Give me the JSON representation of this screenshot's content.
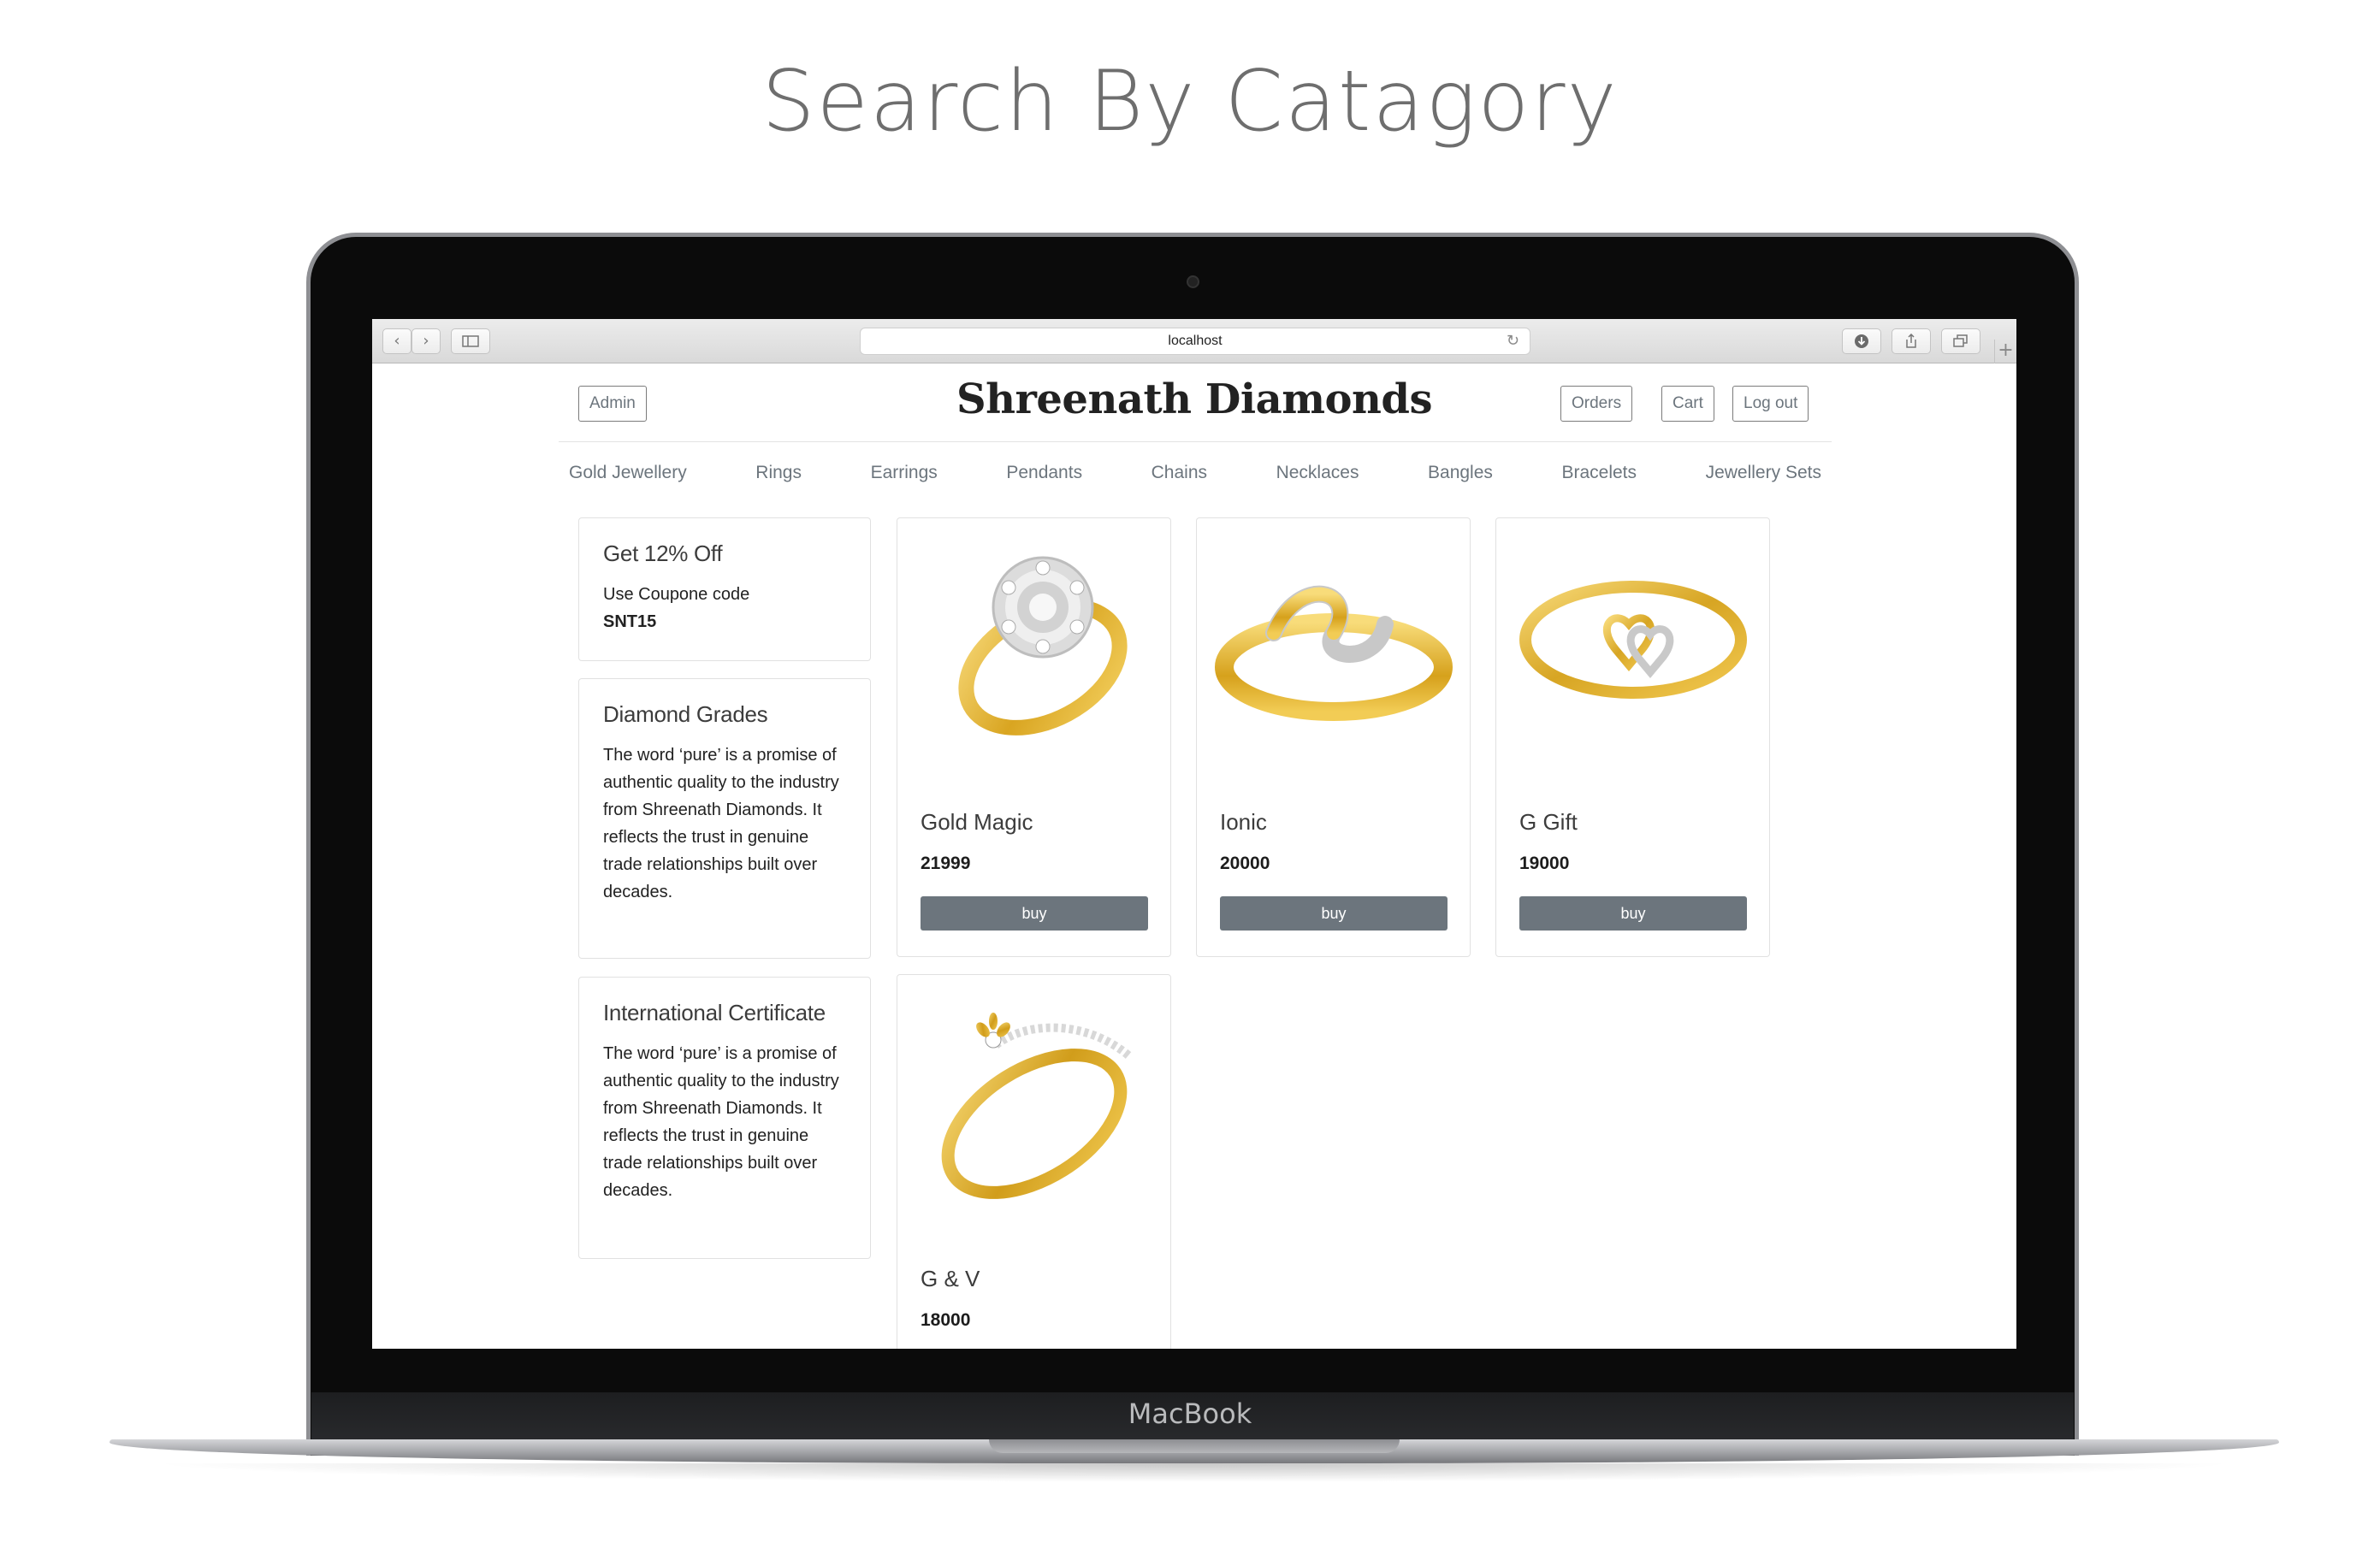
{
  "headline": "Search By Catagory",
  "device": {
    "brand": "MacBook"
  },
  "browser": {
    "url": "localhost",
    "back_icon": "chevron-left-icon",
    "forward_icon": "chevron-right-icon"
  },
  "header": {
    "admin_label": "Admin",
    "site_title": "Shreenath Diamonds",
    "orders_label": "Orders",
    "cart_label": "Cart",
    "logout_label": "Log out"
  },
  "nav": [
    "Gold Jewellery",
    "Rings",
    "Earrings",
    "Pendants",
    "Chains",
    "Necklaces",
    "Bangles",
    "Bracelets",
    "Jewellery Sets"
  ],
  "sidebar": {
    "offer": {
      "title": "Get 12% Off",
      "text": "Use Coupone code",
      "code": "SNT15"
    },
    "grades": {
      "title": "Diamond Grades",
      "text": "The word ‘pure’ is a promise of authentic quality to the industry from Shreenath Diamonds. It reflects the trust in genuine trade relationships built over decades."
    },
    "certificate": {
      "title": "International Certificate",
      "text": "The word ‘pure’ is a promise of authentic quality to the industry from Shreenath Diamonds. It reflects the trust in genuine trade relationships built over decades."
    }
  },
  "products": [
    {
      "name": "Gold Magic",
      "price": "21999",
      "button": "buy"
    },
    {
      "name": "Ionic",
      "price": "20000",
      "button": "buy"
    },
    {
      "name": "G Gift",
      "price": "19000",
      "button": "buy"
    },
    {
      "name": "G & V",
      "price": "18000"
    }
  ],
  "colors": {
    "button_gray": "#6c757d",
    "gold": "#e0b53c",
    "silver": "#c9c9c9"
  }
}
